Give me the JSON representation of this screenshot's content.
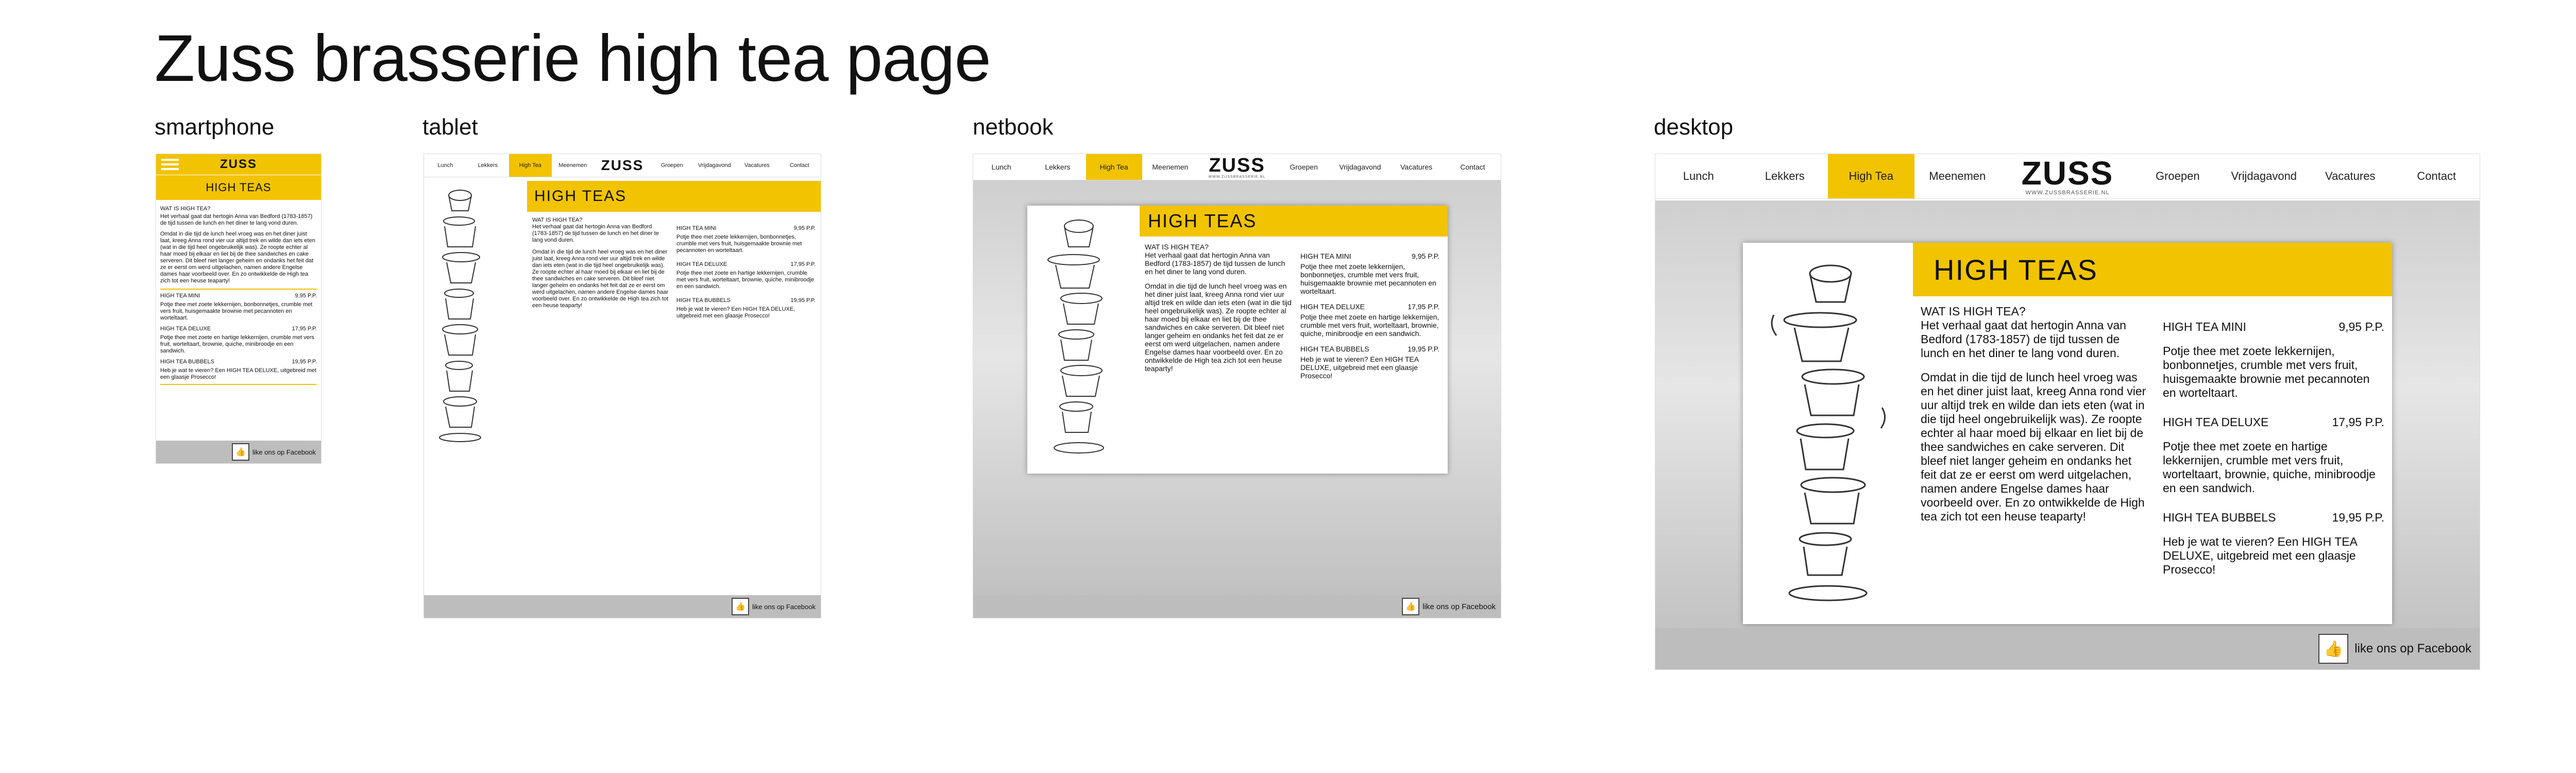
{
  "title": "Zuss brasserie high tea page",
  "devices": {
    "smartphone": "smartphone",
    "tablet": "tablet",
    "netbook": "netbook",
    "desktop": "desktop"
  },
  "nav": [
    "Lunch",
    "Lekkers",
    "High Tea",
    "Meenemen",
    "Groepen",
    "Vrijdagavond",
    "Vacatures",
    "Contact"
  ],
  "logo": {
    "main": "ZUSS",
    "sub": "WWW.ZUSSBRASSERIE.NL"
  },
  "panel_title": "HIGH TEAS",
  "intro": {
    "heading": "WAT IS HIGH TEA?",
    "p1": "Het verhaal gaat dat hertogin Anna van Bedford (1783-1857) de tijd tussen de lunch en het diner te lang vond duren.",
    "p2": "Omdat in die tijd de lunch heel vroeg was en het diner juist laat, kreeg Anna rond vier uur altijd trek en wilde dan iets eten (wat in die tijd heel ongebruikelijk was). Ze roopte echter al haar moed bij elkaar en liet bij de thee sandwiches en cake serveren. Dit bleef niet langer geheim en ondanks het feit dat ze er eerst om werd uitgelachen, namen andere Engelse dames haar voorbeeld over. En zo ontwikkelde de High tea zich tot een heuse teaparty!"
  },
  "menu": [
    {
      "name": "HIGH TEA MINI",
      "price": "9,95 P.P.",
      "desc": "Potje thee met zoete lekkernijen, bonbonnetjes, crumble met vers fruit, huisgemaakte brownie met pecannoten en worteltaart."
    },
    {
      "name": "HIGH TEA DELUXE",
      "price": "17,95 P.P.",
      "desc": "Potje thee met zoete en hartige lekkernijen, crumble met vers fruit, worteltaart, brownie, quiche, minibroodje en een sandwich."
    },
    {
      "name": "HIGH TEA BUBBELS",
      "price": "19,95 P.P.",
      "desc": "Heb je wat te vieren? Een HIGH TEA DELUXE, uitgebreid met een glaasje Prosecco!"
    }
  ],
  "facebook": "like ons op Facebook",
  "fb_icon_glyph": "👍",
  "colors": {
    "accent": "#f2c300",
    "footer": "#bdbdbd"
  }
}
